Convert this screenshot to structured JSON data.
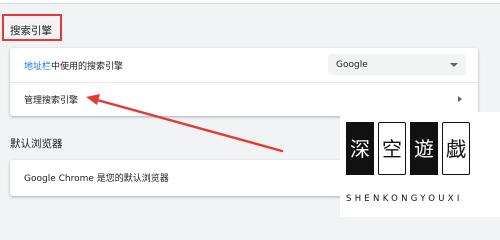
{
  "search_section": {
    "title": "搜索引擎",
    "address_bar_row": {
      "label_link": "地址栏",
      "label_rest": "中使用的搜索引擎",
      "engine_value": "Google"
    },
    "manage_row": {
      "label": "管理搜索引擎"
    }
  },
  "default_browser_section": {
    "title": "默认浏览器",
    "status_text": "Google Chrome 是您的默认浏览器"
  },
  "watermark": {
    "chars": [
      "深",
      "空",
      "遊",
      "戯"
    ],
    "pinyin": "SHENKONGYOUXI"
  },
  "colors": {
    "accent_link": "#1a73e8",
    "annotation_red": "#e53935",
    "page_bg": "#f1f3f4",
    "card_bg": "#ffffff"
  },
  "icons": {
    "select_arrow": "chevron-down-icon",
    "row_arrow": "chevron-right-icon"
  }
}
